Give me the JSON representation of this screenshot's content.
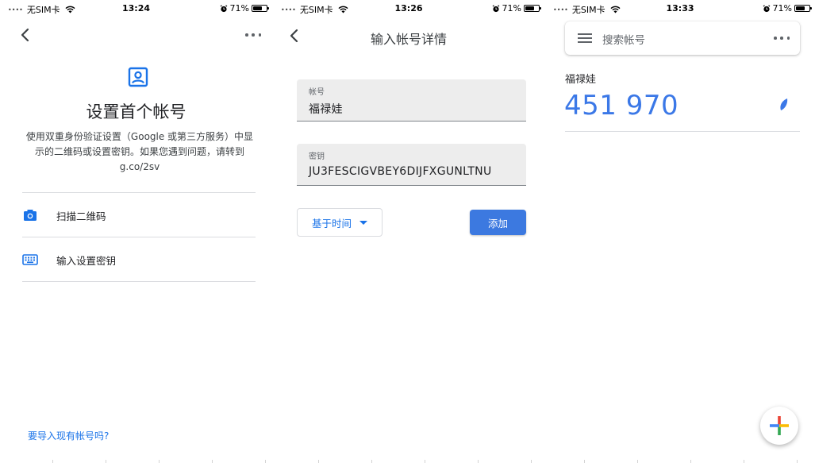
{
  "screens": [
    {
      "status": {
        "carrier": "无SIM卡",
        "time": "13:24",
        "battery": "71%"
      },
      "title": "设置首个帐号",
      "description": "使用双重身份验证设置（Google 或第三方服务）中显示的二维码或设置密钥。如果您遇到问题，请转到 g.co/2sv",
      "options": [
        {
          "label": "扫描二维码",
          "icon": "camera-icon"
        },
        {
          "label": "输入设置密钥",
          "icon": "keyboard-icon"
        }
      ],
      "import_link": "要导入现有帐号吗?"
    },
    {
      "status": {
        "carrier": "无SIM卡",
        "time": "13:26",
        "battery": "71%"
      },
      "title": "输入帐号详情",
      "account_field": {
        "label": "帐号",
        "value": "福禄娃"
      },
      "key_field": {
        "label": "密钥",
        "value": "JU3FESCIGVBEY6DIJFXGUNLTNU"
      },
      "type_select": "基于时间",
      "add_button": "添加"
    },
    {
      "status": {
        "carrier": "无SIM卡",
        "time": "13:33",
        "battery": "71%"
      },
      "search_placeholder": "搜索帐号",
      "account": {
        "name": "福禄娃",
        "code": "451 970"
      }
    }
  ],
  "colors": {
    "accent": "#1a73e8",
    "code": "#3b78e7",
    "button": "#3c79e0"
  }
}
